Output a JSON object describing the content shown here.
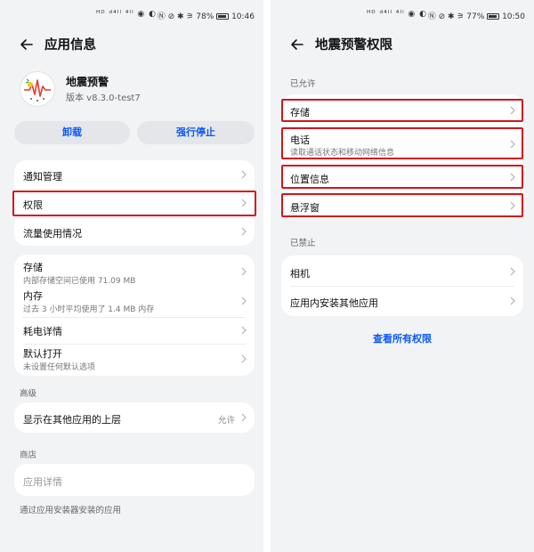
{
  "left": {
    "status": {
      "signals": "ᴴᴰ ᵈ⁴ᴵˡ ⁴ᴵˡ ◉ ◐",
      "indicators": "Ⓝ ⊘ ✱ ⚞ 78%",
      "time": "10:46"
    },
    "title": "应用信息",
    "app": {
      "name": "地震预警",
      "version": "版本 v8.3.0-test7"
    },
    "buttons": {
      "uninstall": "卸载",
      "force_stop": "强行停止"
    },
    "menu": [
      {
        "label": "通知管理"
      },
      {
        "label": "权限"
      },
      {
        "label": "流量使用情况"
      }
    ],
    "details": [
      {
        "label": "存储",
        "sub": "内部存储空间已使用 71.09 MB"
      },
      {
        "label": "内存",
        "sub": "过去 3 小时平均使用了 1.4 MB 内存"
      },
      {
        "label": "耗电详情",
        "sub": ""
      },
      {
        "label": "默认打开",
        "sub": "未设置任何默认选项"
      }
    ],
    "advanced": {
      "section": "高级",
      "label": "显示在其他应用的上层",
      "value": "允许"
    },
    "store": {
      "section": "商店",
      "label": "应用详情",
      "footnote": "通过应用安装器安装的应用"
    }
  },
  "right": {
    "status": {
      "signals": "ᴴᴰ ᵈ⁴ᴵˡ ⁴ᴵˡ ◉ ◐",
      "indicators": "Ⓝ ⊘ ✱ ⚞ 77%",
      "time": "10:50"
    },
    "title": "地震预警权限",
    "allowed_section": "已允许",
    "allowed": [
      {
        "label": "存储",
        "sub": ""
      },
      {
        "label": "电话",
        "sub": "读取通话状态和移动网络信息"
      },
      {
        "label": "位置信息",
        "sub": ""
      },
      {
        "label": "悬浮窗",
        "sub": ""
      }
    ],
    "denied_section": "已禁止",
    "denied": [
      {
        "label": "相机"
      },
      {
        "label": "应用内安装其他应用"
      }
    ],
    "view_all": "查看所有权限"
  },
  "colors": {
    "accent": "#0a59f7",
    "highlight": "#d4141b",
    "background": "#f1f3f5"
  }
}
